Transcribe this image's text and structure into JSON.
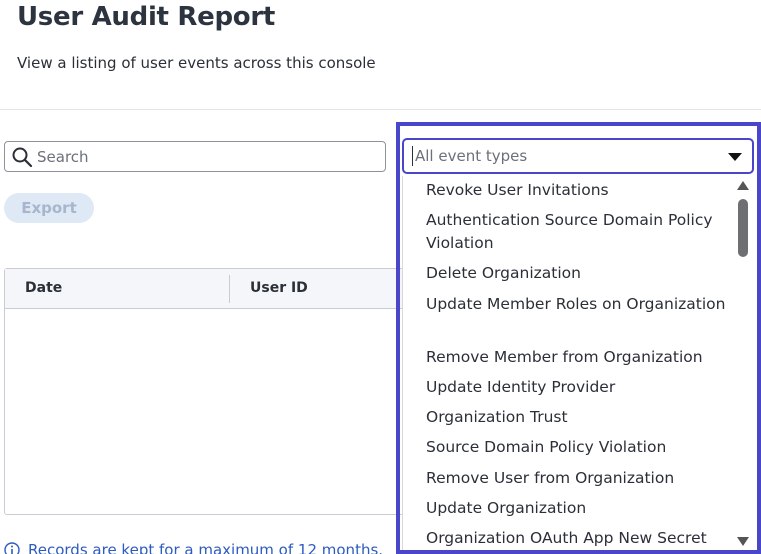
{
  "header": {
    "title": "User Audit Report",
    "subtitle": "View a listing of user events across this console"
  },
  "search": {
    "placeholder": "Search"
  },
  "toolbar": {
    "export_label": "Export"
  },
  "table": {
    "columns": [
      "Date",
      "User ID"
    ]
  },
  "event_filter": {
    "placeholder": "All event types",
    "options": [
      "Revoke User Invitations",
      "Authentication Source Domain Policy Violation",
      "Delete Organization",
      "Update Member Roles on Organization",
      "Remove Member from Organization",
      "Update Identity Provider",
      "Organization Trust",
      "Source Domain Policy Violation",
      "Remove User from Organization",
      "Update Organization",
      "Organization OAuth App New Secret"
    ]
  },
  "footer": {
    "note": "Records are kept for a maximum of 12 months."
  },
  "colors": {
    "accent": "#4a46c9",
    "link": "#2e5bbf",
    "export_bg": "#dfe8f5"
  }
}
